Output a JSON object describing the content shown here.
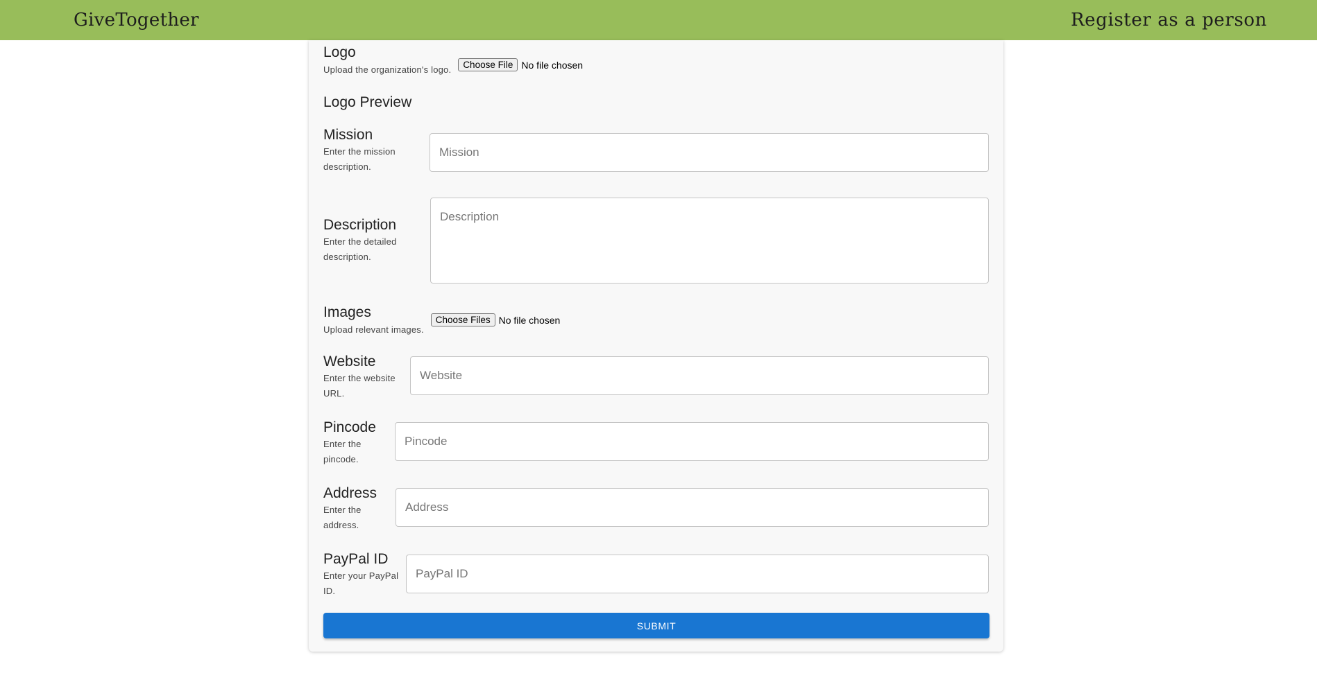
{
  "header": {
    "brand": "GiveTogether",
    "register_link": "Register as a person"
  },
  "form": {
    "logo": {
      "label": "Logo",
      "help": "Upload the organization's logo.",
      "button": "Choose File",
      "status": "No file chosen"
    },
    "logo_preview": {
      "title": "Logo Preview"
    },
    "mission": {
      "label": "Mission",
      "help_line1": "Enter the mission",
      "help_line2": "description.",
      "placeholder": "Mission",
      "value": ""
    },
    "description": {
      "label": "Description",
      "help_line1": "Enter the detailed",
      "help_line2": "description.",
      "placeholder": "Description",
      "value": ""
    },
    "images": {
      "label": "Images",
      "help": "Upload relevant images.",
      "button": "Choose Files",
      "status": "No file chosen"
    },
    "website": {
      "label": "Website",
      "help_line1": "Enter the website",
      "help_line2": "URL.",
      "placeholder": "Website",
      "value": ""
    },
    "pincode": {
      "label": "Pincode",
      "help_line1": "Enter the",
      "help_line2": "pincode.",
      "placeholder": "Pincode",
      "value": ""
    },
    "address": {
      "label": "Address",
      "help_line1": "Enter the",
      "help_line2": "address.",
      "placeholder": "Address",
      "value": ""
    },
    "paypal": {
      "label": "PayPal ID",
      "help_line1": "Enter your PayPal",
      "help_line2": "ID.",
      "placeholder": "PayPal ID",
      "value": ""
    },
    "submit_label": "SUBMIT"
  },
  "colors": {
    "header_bg": "#98bd5a",
    "primary": "#1976d2",
    "card_bg": "#f8f8f8"
  }
}
